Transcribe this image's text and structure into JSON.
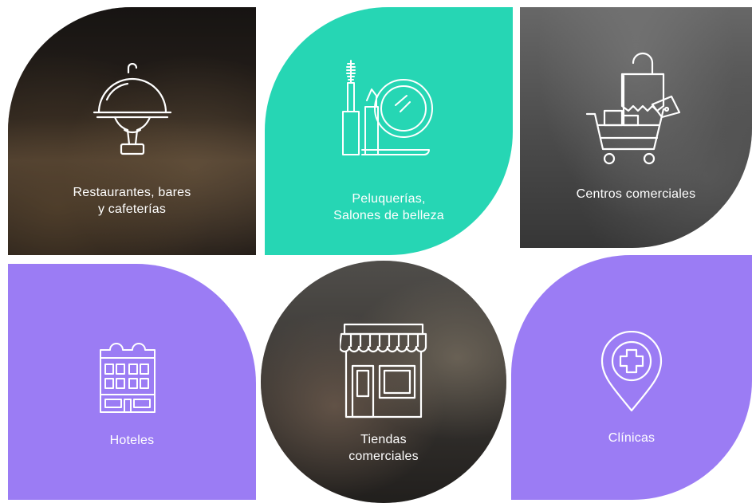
{
  "colors": {
    "teal": "#26d6b4",
    "purple": "#9b7cf4",
    "white": "#ffffff"
  },
  "tiles": [
    {
      "label": "Restaurantes, bares\ny cafeterías",
      "icon": "cloche-icon"
    },
    {
      "label": "Peluquerías,\nSalones de belleza",
      "icon": "beauty-icon"
    },
    {
      "label": "Centros comerciales",
      "icon": "shopping-cart-icon"
    },
    {
      "label": "Hoteles",
      "icon": "hotel-icon"
    },
    {
      "label": "Tiendas\ncomerciales",
      "icon": "storefront-icon"
    },
    {
      "label": "Clínicas",
      "icon": "medical-pin-icon"
    }
  ]
}
